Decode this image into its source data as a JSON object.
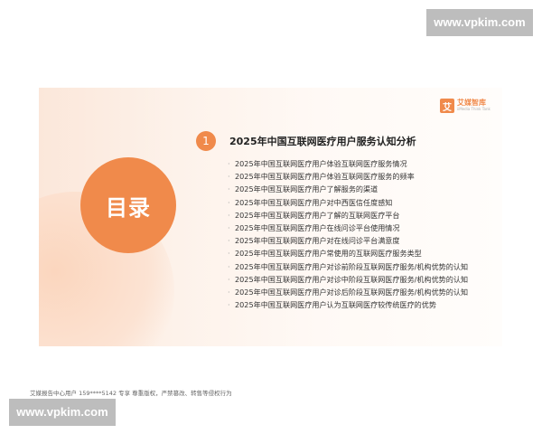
{
  "watermark": "www.vpkim.com",
  "brand": {
    "logo_char": "艾",
    "name": "艾媒智库",
    "subtitle": "iiMedia Think Tank"
  },
  "slide": {
    "contents_label": "目录",
    "section_number": "1",
    "section_title": "2025年中国互联网医疗用户服务认知分析",
    "items": [
      "2025年中国互联网医疗用户体验互联网医疗服务情况",
      "2025年中国互联网医疗用户体验互联网医疗服务的频率",
      "2025年中国互联网医疗用户了解服务的渠道",
      "2025年中国互联网医疗用户对中西医信任度感知",
      "2025年中国互联网医疗用户了解的互联网医疗平台",
      "2025年中国互联网医疗用户在线问诊平台使用情况",
      "2025年中国互联网医疗用户对在线问诊平台满意度",
      "2025年中国互联网医疗用户常使用的互联网医疗服务类型",
      "2025年中国互联网医疗用户对诊前阶段互联网医疗服务/机构优势的认知",
      "2025年中国互联网医疗用户对诊中阶段互联网医疗服务/机构优势的认知",
      "2025年中国互联网医疗用户对诊后阶段互联网医疗服务/机构优势的认知",
      "2025年中国互联网医疗用户认为互联网医疗较传统医疗的优势"
    ]
  },
  "footer": "艾媒报告中心用户 159****5142 专享 尊重版权，严禁篡改、转售等侵权行为",
  "colors": {
    "accent": "#f08a4b"
  }
}
